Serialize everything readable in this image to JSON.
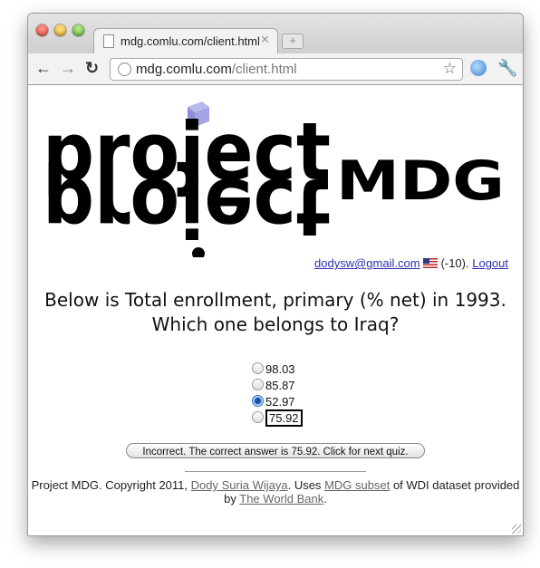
{
  "browser": {
    "tab_title": "mdg.comlu.com/client.html",
    "tab_close": "✕",
    "new_tab": "+",
    "url_host": "mdg.comlu.com",
    "url_path": "/client.html"
  },
  "logo": {
    "project": "project",
    "mdg": "MDG"
  },
  "user": {
    "email": "dodysw@gmail.com",
    "score": "(-10).",
    "logout": "Logout"
  },
  "quiz": {
    "question": "Below is Total enrollment, primary (% net) in 1993. Which one belongs to Iraq?",
    "options": [
      "98.03",
      "85.87",
      "52.97",
      "75.92"
    ],
    "selected_index": 2,
    "correct_index": 3,
    "result": "Incorrect. The correct answer is 75.92. Click for next quiz."
  },
  "footer": {
    "text1": "Project MDG. Copyright 2011,",
    "author": "Dody Suria Wijaya",
    "text2": ". Uses",
    "subset": "MDG subset",
    "text3": "of WDI dataset provided by",
    "bank": "The World Bank",
    "text4": "."
  }
}
